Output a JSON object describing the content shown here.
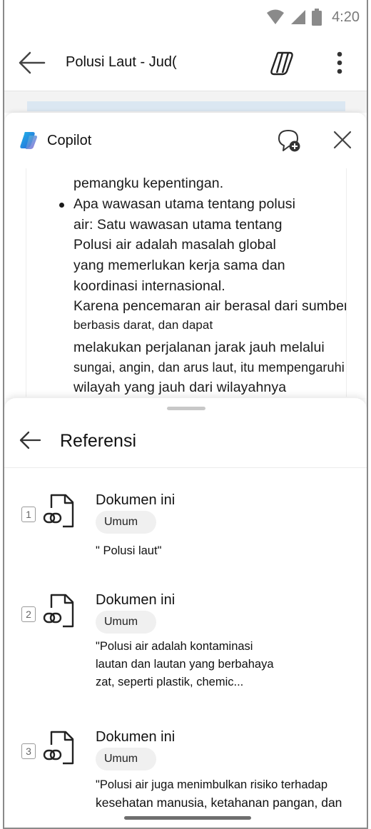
{
  "status_bar": {
    "time": "4:20"
  },
  "app_bar": {
    "doc_title": "Polusi Laut - Jud("
  },
  "copilot": {
    "name": "Copilot",
    "answer_lines": [
      "pemangku kepentingan.",
      "Apa wawasan utama tentang polusi",
      "air: Satu wawasan utama tentang",
      "Polusi air adalah masalah global",
      "yang memerlukan kerja sama dan",
      "koordinasi internasional.",
      "Karena pencemaran air berasal dari sumber",
      "berbasis darat, dan dapat",
      "melakukan perjalanan jarak jauh melalui",
      "sungai, angin, dan arus laut, itu mempengaruhi",
      "wilayah yang jauh dari wilayahnya"
    ]
  },
  "references": {
    "title": "Referensi",
    "items": [
      {
        "number": "1",
        "source": "Dokumen ini",
        "chip": "Umum",
        "quote_lines": [
          "\" Polusi laut\""
        ]
      },
      {
        "number": "2",
        "source": "Dokumen ini",
        "chip": "Umum",
        "quote_lines": [
          "\"Polusi air adalah kontaminasi",
          "lautan dan lautan yang berbahaya",
          "zat, seperti plastik, chemic..."
        ]
      },
      {
        "number": "3",
        "source": "Dokumen ini",
        "chip": "Umum",
        "quote_lines": [
          "\"Polusi air juga menimbulkan risiko terhadap",
          "kesehatan manusia, ketahanan pangan, dan"
        ]
      }
    ]
  }
}
